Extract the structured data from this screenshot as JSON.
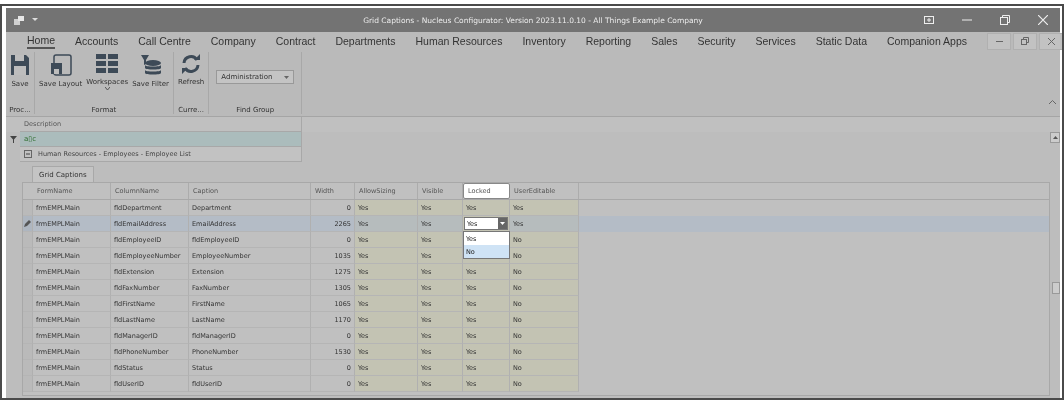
{
  "window": {
    "title": "Grid Captions - Nucleus Configurator: Version 2023.11.0.10 - All Things Example Company"
  },
  "menu_tabs": [
    {
      "label": "Home",
      "selected": true
    },
    {
      "label": "Accounts",
      "selected": false
    },
    {
      "label": "Call Centre",
      "selected": false
    },
    {
      "label": "Company",
      "selected": false
    },
    {
      "label": "Contract",
      "selected": false
    },
    {
      "label": "Departments",
      "selected": false
    },
    {
      "label": "Human Resources",
      "selected": false
    },
    {
      "label": "Inventory",
      "selected": false
    },
    {
      "label": "Reporting",
      "selected": false
    },
    {
      "label": "Sales",
      "selected": false
    },
    {
      "label": "Security",
      "selected": false
    },
    {
      "label": "Services",
      "selected": false
    },
    {
      "label": "Static Data",
      "selected": false
    },
    {
      "label": "Companion Apps",
      "selected": false
    }
  ],
  "ribbon": [
    {
      "caption": "Proc...",
      "items": [
        {
          "kind": "save",
          "label": "Save"
        }
      ]
    },
    {
      "caption": "Format",
      "items": [
        {
          "kind": "layout",
          "label": "Save Layout"
        },
        {
          "kind": "workspaces",
          "label": "Workspaces"
        },
        {
          "kind": "filter",
          "label": "Save Filter"
        }
      ]
    },
    {
      "caption": "Curre...",
      "items": [
        {
          "kind": "refresh",
          "label": "Refresh"
        }
      ]
    },
    {
      "caption": "Find Group",
      "items": [
        {
          "kind": "dropdown",
          "label": "Administration"
        }
      ]
    }
  ],
  "outer_grid": {
    "column": "Description",
    "filter_text": "a▯c",
    "group_row": "Human Resources - Employees - Employee List"
  },
  "panel_tab": "Grid Captions",
  "columns": [
    {
      "label": "FormName",
      "kind": "text",
      "selected": false
    },
    {
      "label": "ColumnName",
      "kind": "text",
      "selected": false
    },
    {
      "label": "Caption",
      "kind": "text",
      "selected": false
    },
    {
      "label": "Width",
      "kind": "number",
      "selected": false
    },
    {
      "label": "AllowSizing",
      "kind": "flag",
      "selected": false
    },
    {
      "label": "Visible",
      "kind": "flag",
      "selected": false
    },
    {
      "label": "Locked",
      "kind": "flag",
      "selected": true
    },
    {
      "label": "UserEditable",
      "kind": "flag",
      "selected": false
    }
  ],
  "rows": [
    {
      "selected": false,
      "cells": [
        "frmEMPLMain",
        "fldDepartment",
        "Department",
        "0",
        "Yes",
        "Yes",
        "Yes",
        "Yes"
      ]
    },
    {
      "selected": true,
      "cells": [
        "frmEMPLMain",
        "fldEmailAddress",
        "EmailAddress",
        "2265",
        "Yes",
        "Yes",
        "Yes",
        "Yes"
      ],
      "editor_options": [
        {
          "label": "Yes",
          "selected": false
        },
        {
          "label": "No",
          "selected": true
        }
      ]
    },
    {
      "selected": false,
      "cells": [
        "frmEMPLMain",
        "fldEmployeeID",
        "fldEmployeeID",
        "0",
        "Yes",
        "Yes",
        null,
        "No"
      ]
    },
    {
      "selected": false,
      "cells": [
        "frmEMPLMain",
        "fldEmployeeNumber",
        "EmployeeNumber",
        "1035",
        "Yes",
        "Yes",
        null,
        "No"
      ]
    },
    {
      "selected": false,
      "cells": [
        "frmEMPLMain",
        "fldExtension",
        "Extension",
        "1275",
        "Yes",
        "Yes",
        "Yes",
        "No"
      ]
    },
    {
      "selected": false,
      "cells": [
        "frmEMPLMain",
        "fldFaxNumber",
        "FaxNumber",
        "1305",
        "Yes",
        "Yes",
        "Yes",
        "No"
      ]
    },
    {
      "selected": false,
      "cells": [
        "frmEMPLMain",
        "fldFirstName",
        "FirstName",
        "1065",
        "Yes",
        "Yes",
        "Yes",
        "No"
      ]
    },
    {
      "selected": false,
      "cells": [
        "frmEMPLMain",
        "fldLastName",
        "LastName",
        "1170",
        "Yes",
        "Yes",
        "Yes",
        "No"
      ]
    },
    {
      "selected": false,
      "cells": [
        "frmEMPLMain",
        "fldManagerID",
        "fldManagerID",
        "0",
        "Yes",
        "Yes",
        "Yes",
        "No"
      ]
    },
    {
      "selected": false,
      "cells": [
        "frmEMPLMain",
        "fldPhoneNumber",
        "PhoneNumber",
        "1530",
        "Yes",
        "Yes",
        "Yes",
        "No"
      ]
    },
    {
      "selected": false,
      "cells": [
        "frmEMPLMain",
        "fldStatus",
        "Status",
        "0",
        "Yes",
        "Yes",
        "Yes",
        "No"
      ]
    },
    {
      "selected": false,
      "cells": [
        "frmEMPLMain",
        "fldUserID",
        "fldUserID",
        "0",
        "Yes",
        "Yes",
        "Yes",
        "No"
      ]
    }
  ]
}
